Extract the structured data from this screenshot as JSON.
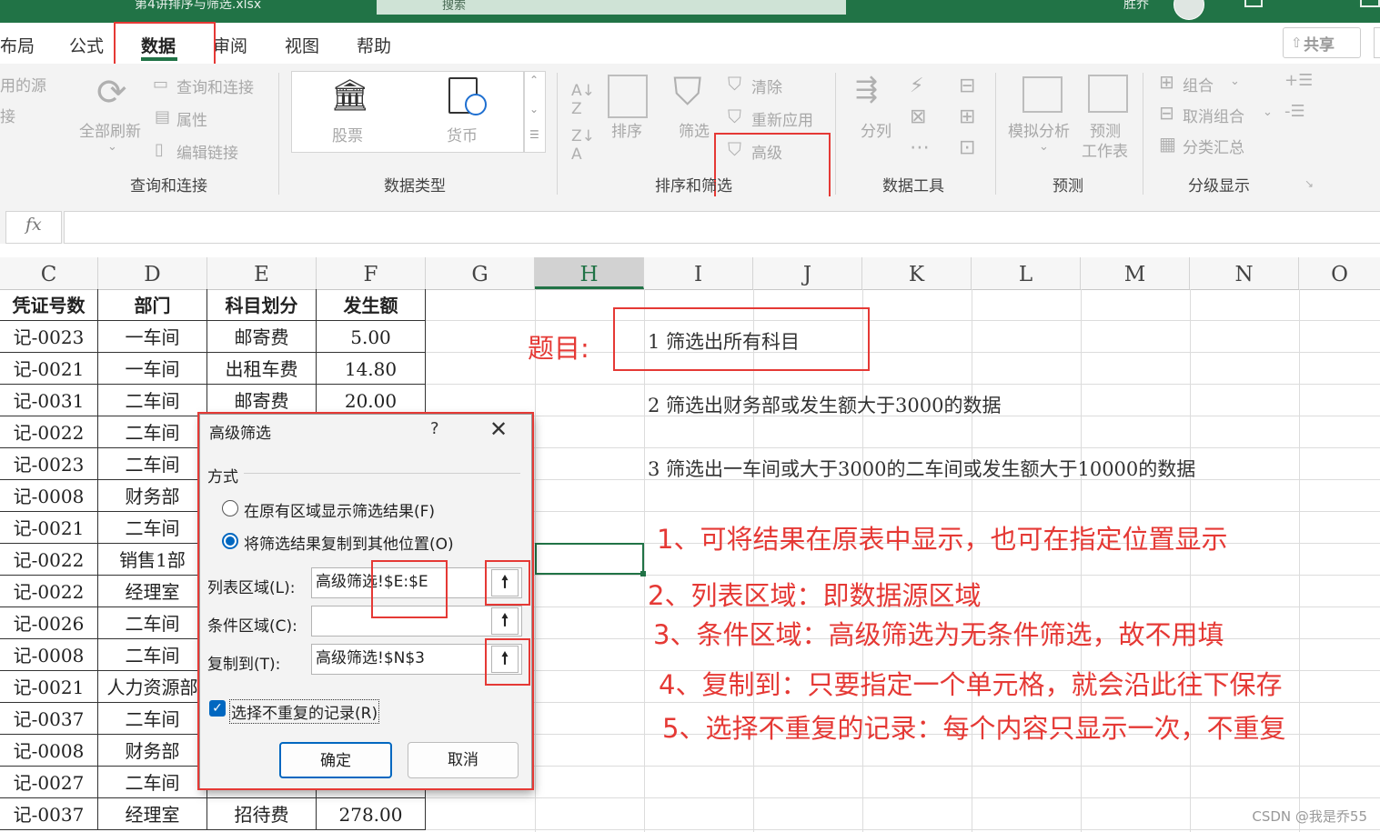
{
  "window": {
    "filename": "第4讲排序与筛选.xlsx",
    "search": "搜索",
    "user": "胜乔"
  },
  "tabs": [
    {
      "label": "布局"
    },
    {
      "label": "公式"
    },
    {
      "label": "数据",
      "active": true
    },
    {
      "label": "审阅"
    },
    {
      "label": "视图"
    },
    {
      "label": "帮助"
    }
  ],
  "share": "共享",
  "ribbon": {
    "query": {
      "partial1": "用的源",
      "partial2": "接",
      "refresh_all": "全部刷新",
      "queries": "查询和连接",
      "properties": "属性",
      "edit_links": "编辑链接",
      "group": "查询和连接"
    },
    "datatypes": {
      "stocks": "股票",
      "currency": "货币",
      "group": "数据类型"
    },
    "sort": {
      "sort": "排序",
      "filter": "筛选",
      "clear": "清除",
      "reapply": "重新应用",
      "advanced": "高级",
      "group": "排序和筛选"
    },
    "tools": {
      "text_to_columns": "分列",
      "group": "数据工具"
    },
    "forecast": {
      "what_if": "模拟分析",
      "forecast_sheet_1": "预测",
      "forecast_sheet_2": "工作表",
      "group": "预测"
    },
    "outline": {
      "group_cmd": "组合",
      "ungroup": "取消组合",
      "subtotal": "分类汇总",
      "group": "分级显示"
    }
  },
  "formula_bar": {
    "fx": "fx",
    "value": ""
  },
  "columns": [
    "C",
    "D",
    "E",
    "F",
    "G",
    "H",
    "I",
    "J",
    "K",
    "L",
    "M",
    "N",
    "O"
  ],
  "table": {
    "headers": [
      "凭证号数",
      "部门",
      "科目划分",
      "发生额"
    ],
    "rows": [
      [
        "记-0023",
        "一车间",
        "邮寄费",
        "5.00"
      ],
      [
        "记-0021",
        "一车间",
        "出租车费",
        "14.80"
      ],
      [
        "记-0031",
        "二车间",
        "邮寄费",
        "20.00"
      ],
      [
        "记-0022",
        "二车间",
        "",
        ""
      ],
      [
        "记-0023",
        "二车间",
        "",
        ""
      ],
      [
        "记-0008",
        "财务部",
        "",
        ""
      ],
      [
        "记-0021",
        "二车间",
        "",
        ""
      ],
      [
        "记-0022",
        "销售1部",
        "",
        ""
      ],
      [
        "记-0022",
        "经理室",
        "",
        ""
      ],
      [
        "记-0026",
        "二车间",
        "",
        ""
      ],
      [
        "记-0008",
        "二车间",
        "",
        ""
      ],
      [
        "记-0021",
        "人力资源部",
        "",
        ""
      ],
      [
        "记-0037",
        "二车间",
        "",
        ""
      ],
      [
        "记-0008",
        "财务部",
        "",
        ""
      ],
      [
        "记-0027",
        "二车间",
        "",
        ""
      ],
      [
        "记-0037",
        "经理室",
        "招待费",
        "278.00"
      ]
    ]
  },
  "annotations": {
    "topic_label": "题目:",
    "task1": "1  筛选出所有科目",
    "task2": "2  筛选出财务部或发生额大于3000的数据",
    "task3": "3  筛选出一车间或大于3000的二车间或发生额大于10000的数据",
    "note1": "1、可将结果在原表中显示，也可在指定位置显示",
    "note2": "2、列表区域：即数据源区域",
    "note3": "3、条件区域：高级筛选为无条件筛选，故不用填",
    "note4": "4、复制到：只要指定一个单元格，就会沿此往下保存",
    "note5": "5、选择不重复的记录：每个内容只显示一次，不重复"
  },
  "dialog": {
    "title": "高级筛选",
    "help": "?",
    "close": "✕",
    "method_label": "方式",
    "radio_in_place": "在原有区域显示筛选结果(F)",
    "radio_copy": "将筛选结果复制到其他位置(O)",
    "list_range_label": "列表区域(L):",
    "list_range_value": "高级筛选!$E:$E",
    "criteria_label": "条件区域(C):",
    "criteria_value": "",
    "copy_to_label": "复制到(T):",
    "copy_to_value": "高级筛选!$N$3",
    "unique_label": "选择不重复的记录(R)",
    "ok": "确定",
    "cancel": "取消"
  },
  "watermark": "CSDN @我是乔55",
  "colors": {
    "excel_green": "#217346",
    "annotation_red": "#e53935",
    "accent_blue": "#0067c0"
  }
}
